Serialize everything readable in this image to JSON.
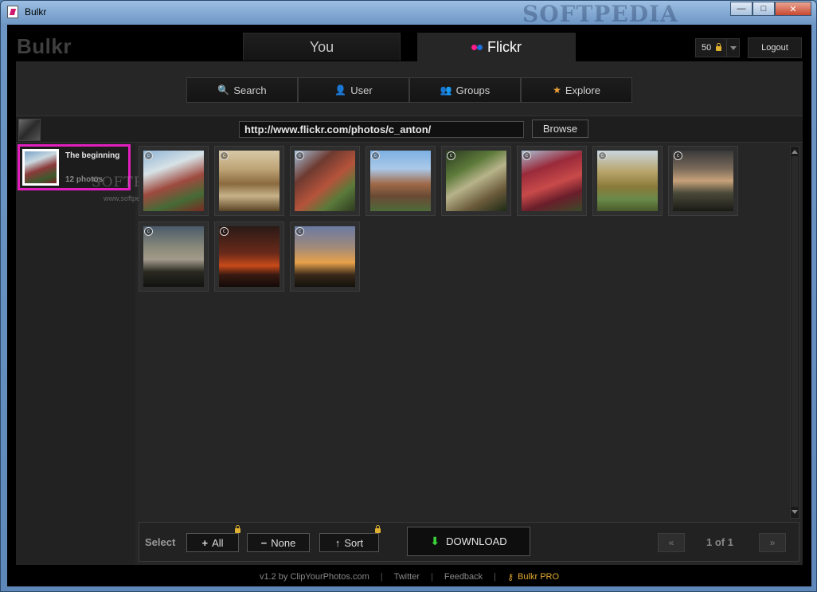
{
  "window": {
    "title": "Bulkr",
    "watermark": "SOFTPEDIA",
    "minimize": "—",
    "maximize": "□",
    "close": "✕"
  },
  "app": {
    "logo": "Bulkr",
    "tabs": [
      {
        "label": "You",
        "active": false
      },
      {
        "label": "Flickr",
        "active": true
      }
    ],
    "count_value": "50",
    "logout_label": "Logout"
  },
  "subtabs": [
    {
      "label": "Search",
      "icon": "search-icon"
    },
    {
      "label": "User",
      "icon": "user-icon"
    },
    {
      "label": "Groups",
      "icon": "groups-icon"
    },
    {
      "label": "Explore",
      "icon": "explore-icon"
    }
  ],
  "url_bar": {
    "value": "http://www.flickr.com/photos/c_anton/",
    "browse_label": "Browse"
  },
  "album": {
    "title": "The beginning",
    "count": "12 photos",
    "watermark": "SOFTPEDIA",
    "watermark_url": "www.softpedia.com"
  },
  "photos": [
    {
      "gradient": "linear-gradient(160deg,#8fb3d6 0%,#d7e2e6 30%,#9e4a3e 55%,#456b35 78%,#7a2a22 100%)"
    },
    {
      "gradient": "linear-gradient(180deg,#d8c9a8 0%,#bfa577 30%,#8a6a3e 55%,#c7b28a 75%,#5a4424 100%)"
    },
    {
      "gradient": "linear-gradient(140deg,#a6c4dd 0%,#6e3a30 30%,#b5533b 55%,#5a7a3a 75%,#2e3a20 100%)"
    },
    {
      "gradient": "linear-gradient(180deg,#7db0e3 0%,#aac9e8 30%,#a06a4a 55%,#6a4a34 75%,#4e6a3a 100%)"
    },
    {
      "gradient": "linear-gradient(150deg,#2a3a20 0%,#5d7a3a 30%,#b7b38a 50%,#6a5a3a 75%,#1e2a16 100%)"
    },
    {
      "gradient": "linear-gradient(160deg,#a9bfd4 0%,#9a2a3a 30%,#c84a4a 55%,#6a1e2a 75%,#3a4a2a 100%)"
    },
    {
      "gradient": "linear-gradient(180deg,#c9d6e0 0%,#b7a46a 35%,#8a7a3a 60%,#6a8a4a 80%,#4a5a2a 100%)"
    },
    {
      "gradient": "linear-gradient(180deg,#3a3a3a 0%,#7a6a5a 30%,#c7a27a 50%,#4a4a3a 70%,#1a1a16 100%)"
    },
    {
      "gradient": "linear-gradient(180deg,#4a5a6a 0%,#8a8a7a 35%,#a29a8a 55%,#2a2a22 75%,#121210 100%)"
    },
    {
      "gradient": "linear-gradient(180deg,#2a1a16 0%,#6a2a1a 45%,#c84a1a 65%,#3a1a12 80%,#120a08 100%)"
    },
    {
      "gradient": "linear-gradient(180deg,#6a7aa2 0%,#a28a7a 35%,#e8a24a 60%,#3a2a1a 80%,#12100a 100%)"
    }
  ],
  "bottom": {
    "select_label": "Select",
    "all_label": "All",
    "none_label": "None",
    "sort_label": "Sort",
    "download_label": "DOWNLOAD",
    "prev_label": "«",
    "next_label": "»",
    "page_indicator": "1 of 1"
  },
  "footer": {
    "version": "v1.2 by",
    "site": "ClipYourPhotos.com",
    "twitter": "Twitter",
    "feedback": "Feedback",
    "pro": "Bulkr PRO",
    "separator": "|"
  }
}
